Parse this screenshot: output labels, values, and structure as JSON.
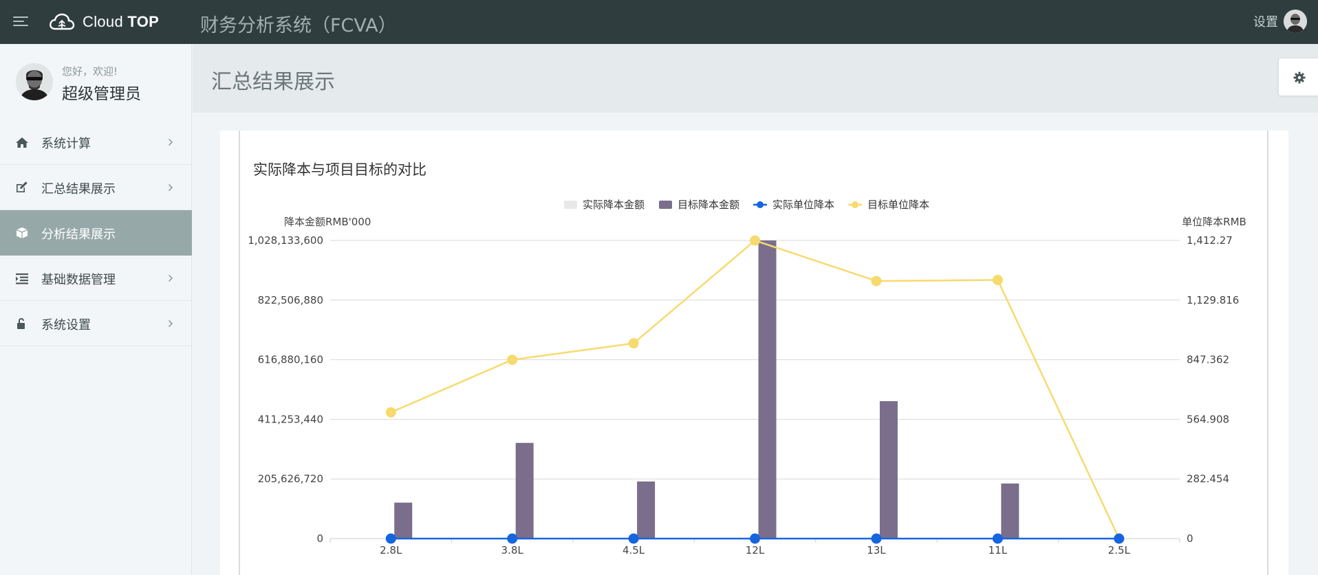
{
  "topbar": {
    "brand": {
      "prefix": "Cloud ",
      "bold": "TOP"
    },
    "app_title": "财务分析系统（FCVA）",
    "settings_label": "设置"
  },
  "sidebar": {
    "greeting": "您好，欢迎!",
    "username": "超级管理员",
    "items": [
      {
        "label": "系统计算",
        "icon": "home-icon",
        "active": false
      },
      {
        "label": "汇总结果展示",
        "icon": "edit-icon",
        "active": false
      },
      {
        "label": "分析结果展示",
        "icon": "cube-icon",
        "active": true
      },
      {
        "label": "基础数据管理",
        "icon": "list-indent-icon",
        "active": false
      },
      {
        "label": "系统设置",
        "icon": "unlock-icon",
        "active": false
      }
    ]
  },
  "page_title": "汇总结果展示",
  "colors": {
    "topbar": "#2f3d3e",
    "sidebar_active": "#97a8a8",
    "bar_actual": "#e8e8e8",
    "bar_target": "#7a6e8c",
    "line_actual": "#1565e0",
    "line_target": "#f7da6e"
  },
  "chart_data": {
    "type": "bar",
    "title": "实际降本与项目目标的对比",
    "categories": [
      "2.8L",
      "3.8L",
      "4.5L",
      "12L",
      "13L",
      "11L",
      "2.5L"
    ],
    "series": [
      {
        "name": "实际降本金额",
        "type": "bar",
        "axis": "left",
        "values": [
          0,
          0,
          0,
          0,
          0,
          0,
          0
        ]
      },
      {
        "name": "目标降本金额",
        "type": "bar",
        "axis": "left",
        "values": [
          124000000,
          330000000,
          197000000,
          1028133600,
          474000000,
          190000000,
          0
        ]
      },
      {
        "name": "实际单位降本",
        "type": "line",
        "axis": "right",
        "values": [
          0,
          0,
          0,
          0,
          0,
          0,
          0
        ]
      },
      {
        "name": "目标单位降本",
        "type": "line",
        "axis": "right",
        "values": [
          598,
          847,
          925,
          1412,
          1220,
          1225,
          0
        ]
      }
    ],
    "ylabel_left": "降本金额RMB'000",
    "ylabel_right": "单位降本RMB",
    "yticks_left": [
      "0",
      "205,626,720",
      "411,253,440",
      "616,880,160",
      "822,506,880",
      "1,028,133,600"
    ],
    "yticks_right": [
      "0",
      "282.454",
      "564.908",
      "847.362",
      "1,129.816",
      "1,412.27"
    ],
    "ylim_left": [
      0,
      1028133600
    ],
    "ylim_right": [
      0,
      1412.27
    ],
    "legend_position": "top-center",
    "grid": true
  }
}
